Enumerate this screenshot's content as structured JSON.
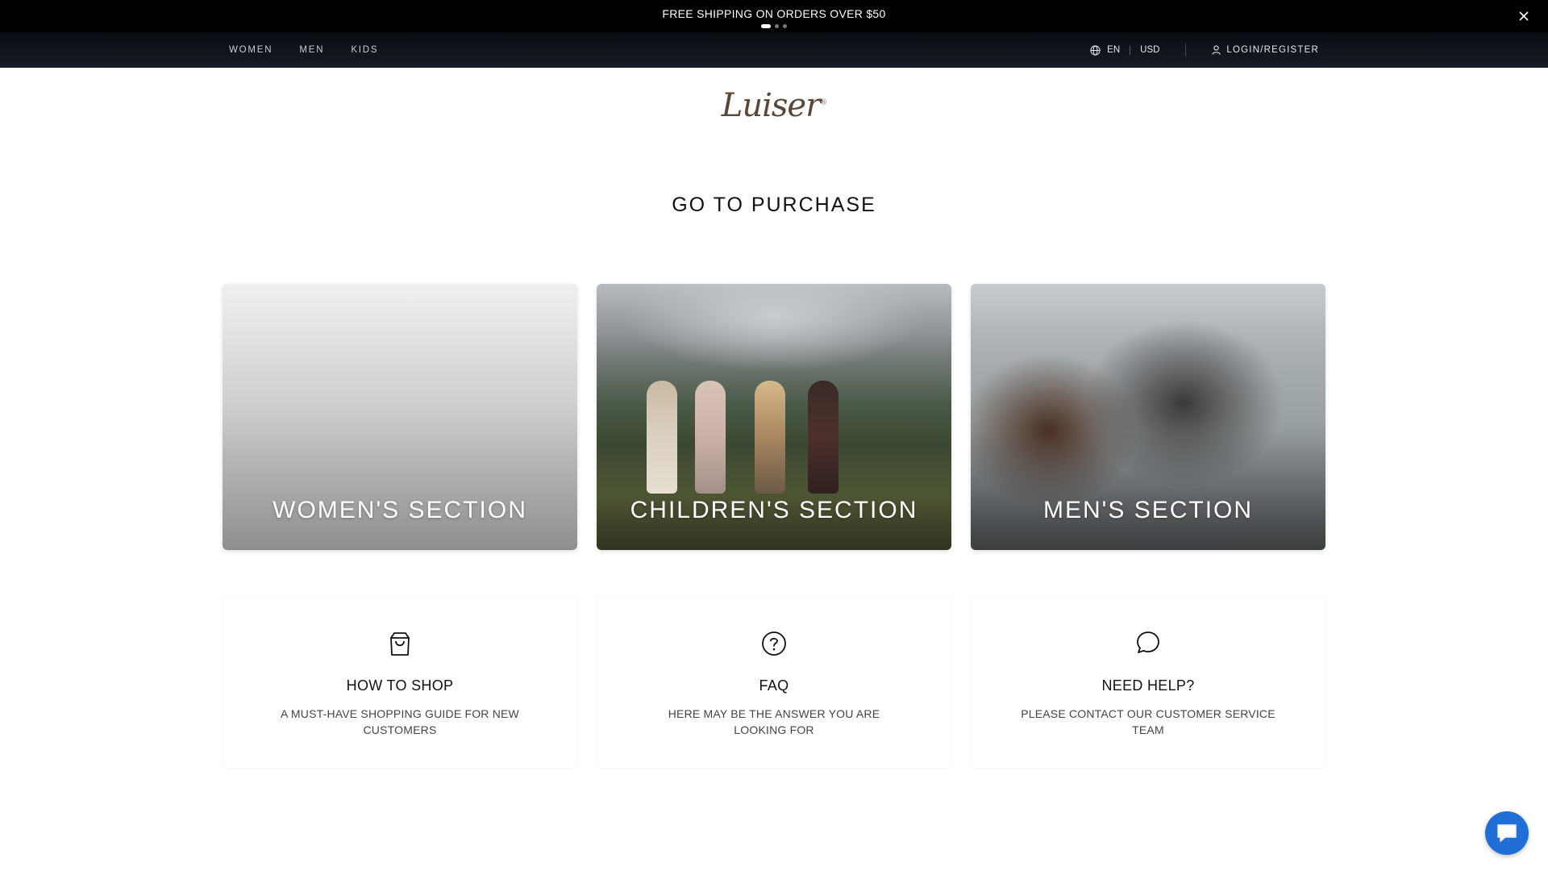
{
  "announcement": {
    "text": "FREE SHIPPING ON ORDERS OVER $50",
    "slide_count": 3,
    "active_slide": 1,
    "close_icon": "close-icon"
  },
  "nav": {
    "links": [
      "WOMEN",
      "MEN",
      "KIDS"
    ],
    "language": "EN",
    "currency": "USD",
    "login_label": "LOGIN/REGISTER"
  },
  "logo": {
    "text": "Luiser",
    "mark": "®"
  },
  "page_title": "GO TO PURCHASE",
  "sections": [
    {
      "label": "WOMEN'S SECTION"
    },
    {
      "label": "CHILDREN'S SECTION"
    },
    {
      "label": "MEN'S SECTION"
    }
  ],
  "info": [
    {
      "icon": "shopping-bag-icon",
      "title": "HOW TO SHOP",
      "desc": "A MUST-HAVE SHOPPING GUIDE FOR NEW CUSTOMERS"
    },
    {
      "icon": "question-circle-icon",
      "title": "FAQ",
      "desc": "HERE MAY BE THE ANSWER YOU ARE LOOKING FOR"
    },
    {
      "icon": "chat-bubble-icon",
      "title": "NEED HELP?",
      "desc": "PLEASE CONTACT OUR CUSTOMER SERVICE TEAM"
    }
  ],
  "colors": {
    "accent": "#1f6fd6",
    "topbar": "#000000",
    "nav": "#111620"
  }
}
